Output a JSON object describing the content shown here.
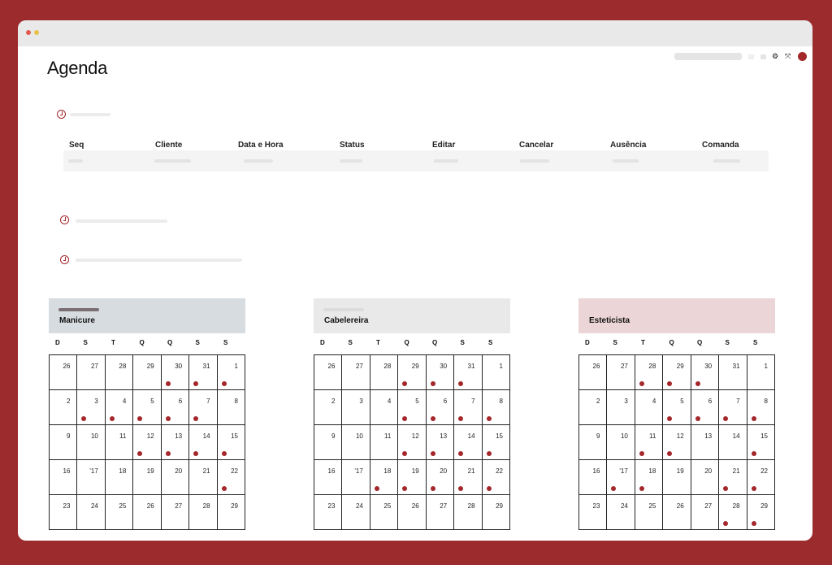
{
  "page": {
    "title": "Agenda"
  },
  "topbar": {
    "icons": [
      "gear-icon",
      "expand-icon",
      "avatar"
    ]
  },
  "table": {
    "headers": [
      "Seq",
      "Cliente",
      "Data e Hora",
      "Status",
      "Editar",
      "Cancelar",
      "Ausência",
      "Comanda"
    ]
  },
  "calendars": [
    {
      "label": "Manicure",
      "header_color": "#d7dce0",
      "bar_color": "#7b6e74",
      "weekdays": [
        "D",
        "S",
        "T",
        "Q",
        "Q",
        "S",
        "S"
      ],
      "days": [
        {
          "n": "26",
          "ev": false
        },
        {
          "n": "27",
          "ev": false
        },
        {
          "n": "28",
          "ev": false
        },
        {
          "n": "29",
          "ev": false
        },
        {
          "n": "30",
          "ev": true
        },
        {
          "n": "31",
          "ev": true
        },
        {
          "n": "1",
          "ev": true
        },
        {
          "n": "2",
          "ev": false
        },
        {
          "n": "3",
          "ev": true
        },
        {
          "n": "4",
          "ev": true
        },
        {
          "n": "5",
          "ev": true
        },
        {
          "n": "6",
          "ev": true
        },
        {
          "n": "7",
          "ev": true
        },
        {
          "n": "8",
          "ev": false
        },
        {
          "n": "9",
          "ev": false
        },
        {
          "n": "10",
          "ev": false
        },
        {
          "n": "11",
          "ev": false
        },
        {
          "n": "12",
          "ev": true
        },
        {
          "n": "13",
          "ev": true
        },
        {
          "n": "14",
          "ev": true
        },
        {
          "n": "15",
          "ev": true
        },
        {
          "n": "16",
          "ev": false
        },
        {
          "n": "'17",
          "ev": false
        },
        {
          "n": "18",
          "ev": false
        },
        {
          "n": "19",
          "ev": false
        },
        {
          "n": "20",
          "ev": false
        },
        {
          "n": "21",
          "ev": false
        },
        {
          "n": "22",
          "ev": true
        },
        {
          "n": "23",
          "ev": false
        },
        {
          "n": "24",
          "ev": false
        },
        {
          "n": "25",
          "ev": false
        },
        {
          "n": "26",
          "ev": false
        },
        {
          "n": "27",
          "ev": false
        },
        {
          "n": "28",
          "ev": false
        },
        {
          "n": "29",
          "ev": false
        }
      ]
    },
    {
      "label": "Cabelereira",
      "header_color": "#e9e9e9",
      "bar_color": "#dcdcdc",
      "weekdays": [
        "D",
        "S",
        "T",
        "Q",
        "Q",
        "S",
        "S"
      ],
      "days": [
        {
          "n": "26",
          "ev": false
        },
        {
          "n": "27",
          "ev": false
        },
        {
          "n": "28",
          "ev": false
        },
        {
          "n": "29",
          "ev": true
        },
        {
          "n": "30",
          "ev": true
        },
        {
          "n": "31",
          "ev": true
        },
        {
          "n": "1",
          "ev": false
        },
        {
          "n": "2",
          "ev": false
        },
        {
          "n": "3",
          "ev": false
        },
        {
          "n": "4",
          "ev": false
        },
        {
          "n": "5",
          "ev": true
        },
        {
          "n": "6",
          "ev": true
        },
        {
          "n": "7",
          "ev": true
        },
        {
          "n": "8",
          "ev": true
        },
        {
          "n": "9",
          "ev": false
        },
        {
          "n": "10",
          "ev": false
        },
        {
          "n": "11",
          "ev": false
        },
        {
          "n": "12",
          "ev": true
        },
        {
          "n": "13",
          "ev": true
        },
        {
          "n": "14",
          "ev": true
        },
        {
          "n": "15",
          "ev": true
        },
        {
          "n": "16",
          "ev": false
        },
        {
          "n": "'17",
          "ev": false
        },
        {
          "n": "18",
          "ev": true
        },
        {
          "n": "19",
          "ev": true
        },
        {
          "n": "20",
          "ev": true
        },
        {
          "n": "21",
          "ev": true
        },
        {
          "n": "22",
          "ev": true
        },
        {
          "n": "23",
          "ev": false
        },
        {
          "n": "24",
          "ev": false
        },
        {
          "n": "25",
          "ev": false
        },
        {
          "n": "26",
          "ev": false
        },
        {
          "n": "27",
          "ev": false
        },
        {
          "n": "28",
          "ev": false
        },
        {
          "n": "29",
          "ev": false
        }
      ]
    },
    {
      "label": "Esteticista",
      "header_color": "#ecd5d6",
      "bar_color": "",
      "weekdays": [
        "D",
        "S",
        "T",
        "Q",
        "Q",
        "S",
        "S"
      ],
      "days": [
        {
          "n": "26",
          "ev": false
        },
        {
          "n": "27",
          "ev": false
        },
        {
          "n": "28",
          "ev": true
        },
        {
          "n": "29",
          "ev": true
        },
        {
          "n": "30",
          "ev": true
        },
        {
          "n": "31",
          "ev": false
        },
        {
          "n": "1",
          "ev": false
        },
        {
          "n": "2",
          "ev": false
        },
        {
          "n": "3",
          "ev": false
        },
        {
          "n": "4",
          "ev": false
        },
        {
          "n": "5",
          "ev": true
        },
        {
          "n": "6",
          "ev": true
        },
        {
          "n": "7",
          "ev": true
        },
        {
          "n": "8",
          "ev": true
        },
        {
          "n": "9",
          "ev": false
        },
        {
          "n": "10",
          "ev": false
        },
        {
          "n": "11",
          "ev": true
        },
        {
          "n": "12",
          "ev": true
        },
        {
          "n": "13",
          "ev": false
        },
        {
          "n": "14",
          "ev": false
        },
        {
          "n": "15",
          "ev": true
        },
        {
          "n": "16",
          "ev": false
        },
        {
          "n": "'17",
          "ev": true
        },
        {
          "n": "18",
          "ev": true
        },
        {
          "n": "19",
          "ev": false
        },
        {
          "n": "20",
          "ev": false
        },
        {
          "n": "21",
          "ev": true
        },
        {
          "n": "22",
          "ev": true
        },
        {
          "n": "23",
          "ev": false
        },
        {
          "n": "24",
          "ev": false
        },
        {
          "n": "25",
          "ev": false
        },
        {
          "n": "26",
          "ev": false
        },
        {
          "n": "27",
          "ev": false
        },
        {
          "n": "28",
          "ev": true
        },
        {
          "n": "29",
          "ev": true
        }
      ]
    }
  ],
  "colors": {
    "accent": "#a4272b",
    "background": "#9c2b2e"
  }
}
